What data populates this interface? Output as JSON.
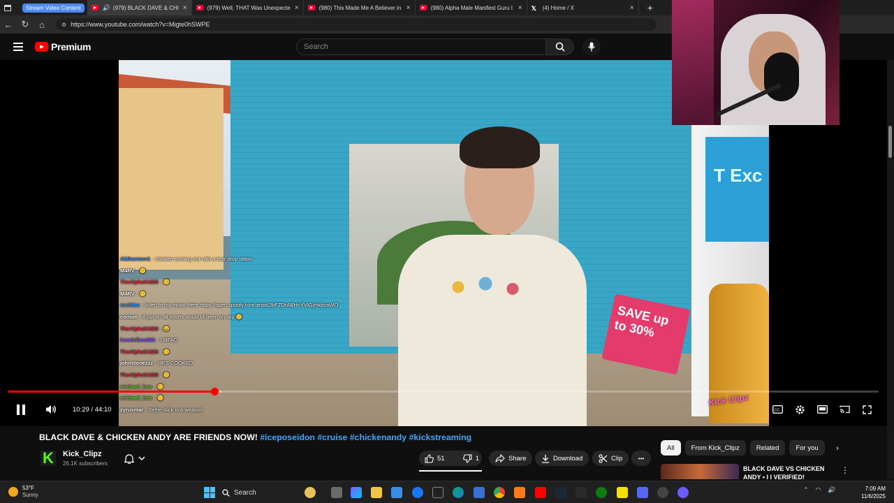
{
  "browser": {
    "tab_group_label": "Stream Video Content",
    "tabs": [
      {
        "title": "(979) BLACK DAVE & CHICK",
        "favicon": "youtube-icon",
        "active": true,
        "audio": true
      },
      {
        "title": "(979) Well, THAT Was Unexpected",
        "favicon": "youtube-icon",
        "active": false
      },
      {
        "title": "(980) This Made Me A Believer in",
        "favicon": "youtube-icon",
        "active": false
      },
      {
        "title": "(980) Alpha Male Manifest Guru I",
        "favicon": "youtube-icon",
        "active": false
      },
      {
        "title": "(4) Home / X",
        "favicon": "x-icon",
        "active": false
      }
    ],
    "close_glyph": "×",
    "new_tab_glyph": "+",
    "url": "https://www.youtube.com/watch?v=Migte0hSWPE"
  },
  "header": {
    "brand": "Premium",
    "search_placeholder": "Search"
  },
  "player": {
    "time_display": "10:29 / 44:10",
    "progress_fraction": 0.237,
    "buffer_fraction": 0.245,
    "watermark": "Kick Clipz"
  },
  "video_overlay": {
    "sign_text": "SAVE up to 30%",
    "panel_text": "T Exc"
  },
  "chat": [
    {
      "user": "AkDaemon1",
      "user_color": "#4a90e2",
      "msg": "chicken coming out with a tear drop tattoo"
    },
    {
      "user": "M4RV",
      "user_color": "#ffffff",
      "msg": "🙂"
    },
    {
      "user": "TheAlphaKid28",
      "user_color": "#e0304a",
      "msg": "🙂"
    },
    {
      "user": "M4RV",
      "user_color": "#ffffff",
      "msg": "🙂"
    },
    {
      "user": "cschlau",
      "user_color": "#3aa0ff",
      "msg": "listen to my music here https://open.spotify.com/artist/2bFZDrABHnYVlGzhkbvaWO"
    },
    {
      "user": "corium",
      "user_color": "#ffffff",
      "msg": "if put on all shorts would of been on sky 🙂"
    },
    {
      "user": "TheAlphaKid28",
      "user_color": "#e0304a",
      "msg": "😄"
    },
    {
      "user": "hoodvibes365",
      "user_color": "#8a5cff",
      "msg": "LMFAO"
    },
    {
      "user": "TheAlphaKid28",
      "user_color": "#e0304a",
      "msg": "🙂"
    },
    {
      "user": "johnstonezzz",
      "user_color": "#ffffff",
      "msg": "HES COOKED"
    },
    {
      "user": "TheAlphaKid28",
      "user_color": "#e0304a",
      "msg": "🙂"
    },
    {
      "user": "michael_boo",
      "user_color": "#7ac74f",
      "msg": "🙂"
    },
    {
      "user": "michael_boo",
      "user_color": "#7ac74f",
      "msg": "🙂"
    },
    {
      "user": "zyrusmar",
      "user_color": "#ffffff",
      "msg": "Selfie stick is a weapon"
    }
  ],
  "video": {
    "title": "BLACK DAVE & CHICKEN ANDY ARE FRIENDS NOW!",
    "hashtags": "#iceposeidon #cruise #chickenandy #kickstreaming",
    "channel_name": "Kick_Clipz",
    "subscribers": "26.1K subscribers",
    "likes": "51",
    "dislikes": "1",
    "share_label": "Share",
    "download_label": "Download",
    "clip_label": "Clip",
    "more_glyph": "•••"
  },
  "recommendations": {
    "chips": [
      "All",
      "From Kick_Clipz",
      "Related",
      "For you"
    ],
    "first_title": "BLACK DAVE VS CHICKEN ANDY • I I VERIFIED!"
  },
  "taskbar": {
    "temperature": "53°F",
    "condition": "Sunny",
    "search_label": "Search",
    "time": "7:09 AM",
    "date": "11/6/2025"
  },
  "colors": {
    "youtube_red": "#ff0000",
    "link_blue": "#3ea6ff",
    "kick_green": "#53fc18",
    "tab_group_blue": "#4c8bf5"
  }
}
